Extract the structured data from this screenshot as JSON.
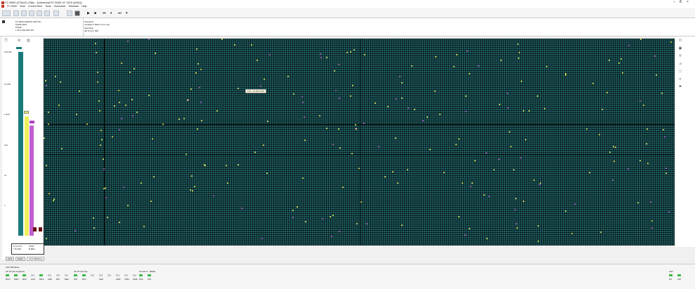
{
  "window": {
    "title": "FC 5000 (OTALE)   CMio - [Universal FC 5000 1F 1125 (4251)]",
    "controls": [
      "–",
      "ẟ",
      "×"
    ]
  },
  "menu": [
    "FC 5000",
    "View",
    "Current feed",
    "Tools",
    "Overviews",
    "Windows",
    "Help"
  ],
  "info": {
    "device_line1": "FC 5000 N1E6SF (APP 81)",
    "device_line2": "19340-4923",
    "device_line3": "PONE",
    "device_line4": "1 95 3 902 929 766",
    "operation_title": "Operation",
    "operation_line1": "resultate 2 Differ 0 errr mal",
    "operation_title2": "Operation",
    "operation_line2": "[94 |3 33 1 934"
  },
  "axis": {
    "labels": [
      "100,000",
      "10,000",
      "1,000",
      "100",
      "10",
      "1"
    ]
  },
  "tooltip": "L34 / 13 494 1133",
  "legend": {
    "l1": "0 % 17%",
    "l2": "7 B 33%",
    "l3": "COM",
    "l4": "B 89%"
  },
  "tabs": [
    "ACS",
    "Mode",
    "ACS DB/Mode"
  ],
  "status": {
    "left_caption": "ACS DB Mode",
    "group1_title": "AP 18 (SA 14)(HUA)",
    "group1_labels": [
      "RUN",
      "DRD",
      "BUF",
      "ACC",
      "DRS",
      "FAB",
      "DIV",
      "REV"
    ],
    "group2_title": "AP 18 (SA 1N)",
    "group2_labels": [
      "SIN",
      "BUT",
      "",
      "SAP",
      "",
      "AMS",
      "TRM",
      "AMS"
    ],
    "group3_title": "KO MC 5 - 9999s",
    "group3_labels": [
      "PAF",
      "PSI"
    ],
    "right_title": "ANT",
    "right_labels": [
      "PU",
      "CIP"
    ]
  },
  "colors": {
    "grid": "#1f5e61",
    "yellow": "#f0f05a",
    "magenta": "#c060d0",
    "teal": "#1b7b7b"
  }
}
